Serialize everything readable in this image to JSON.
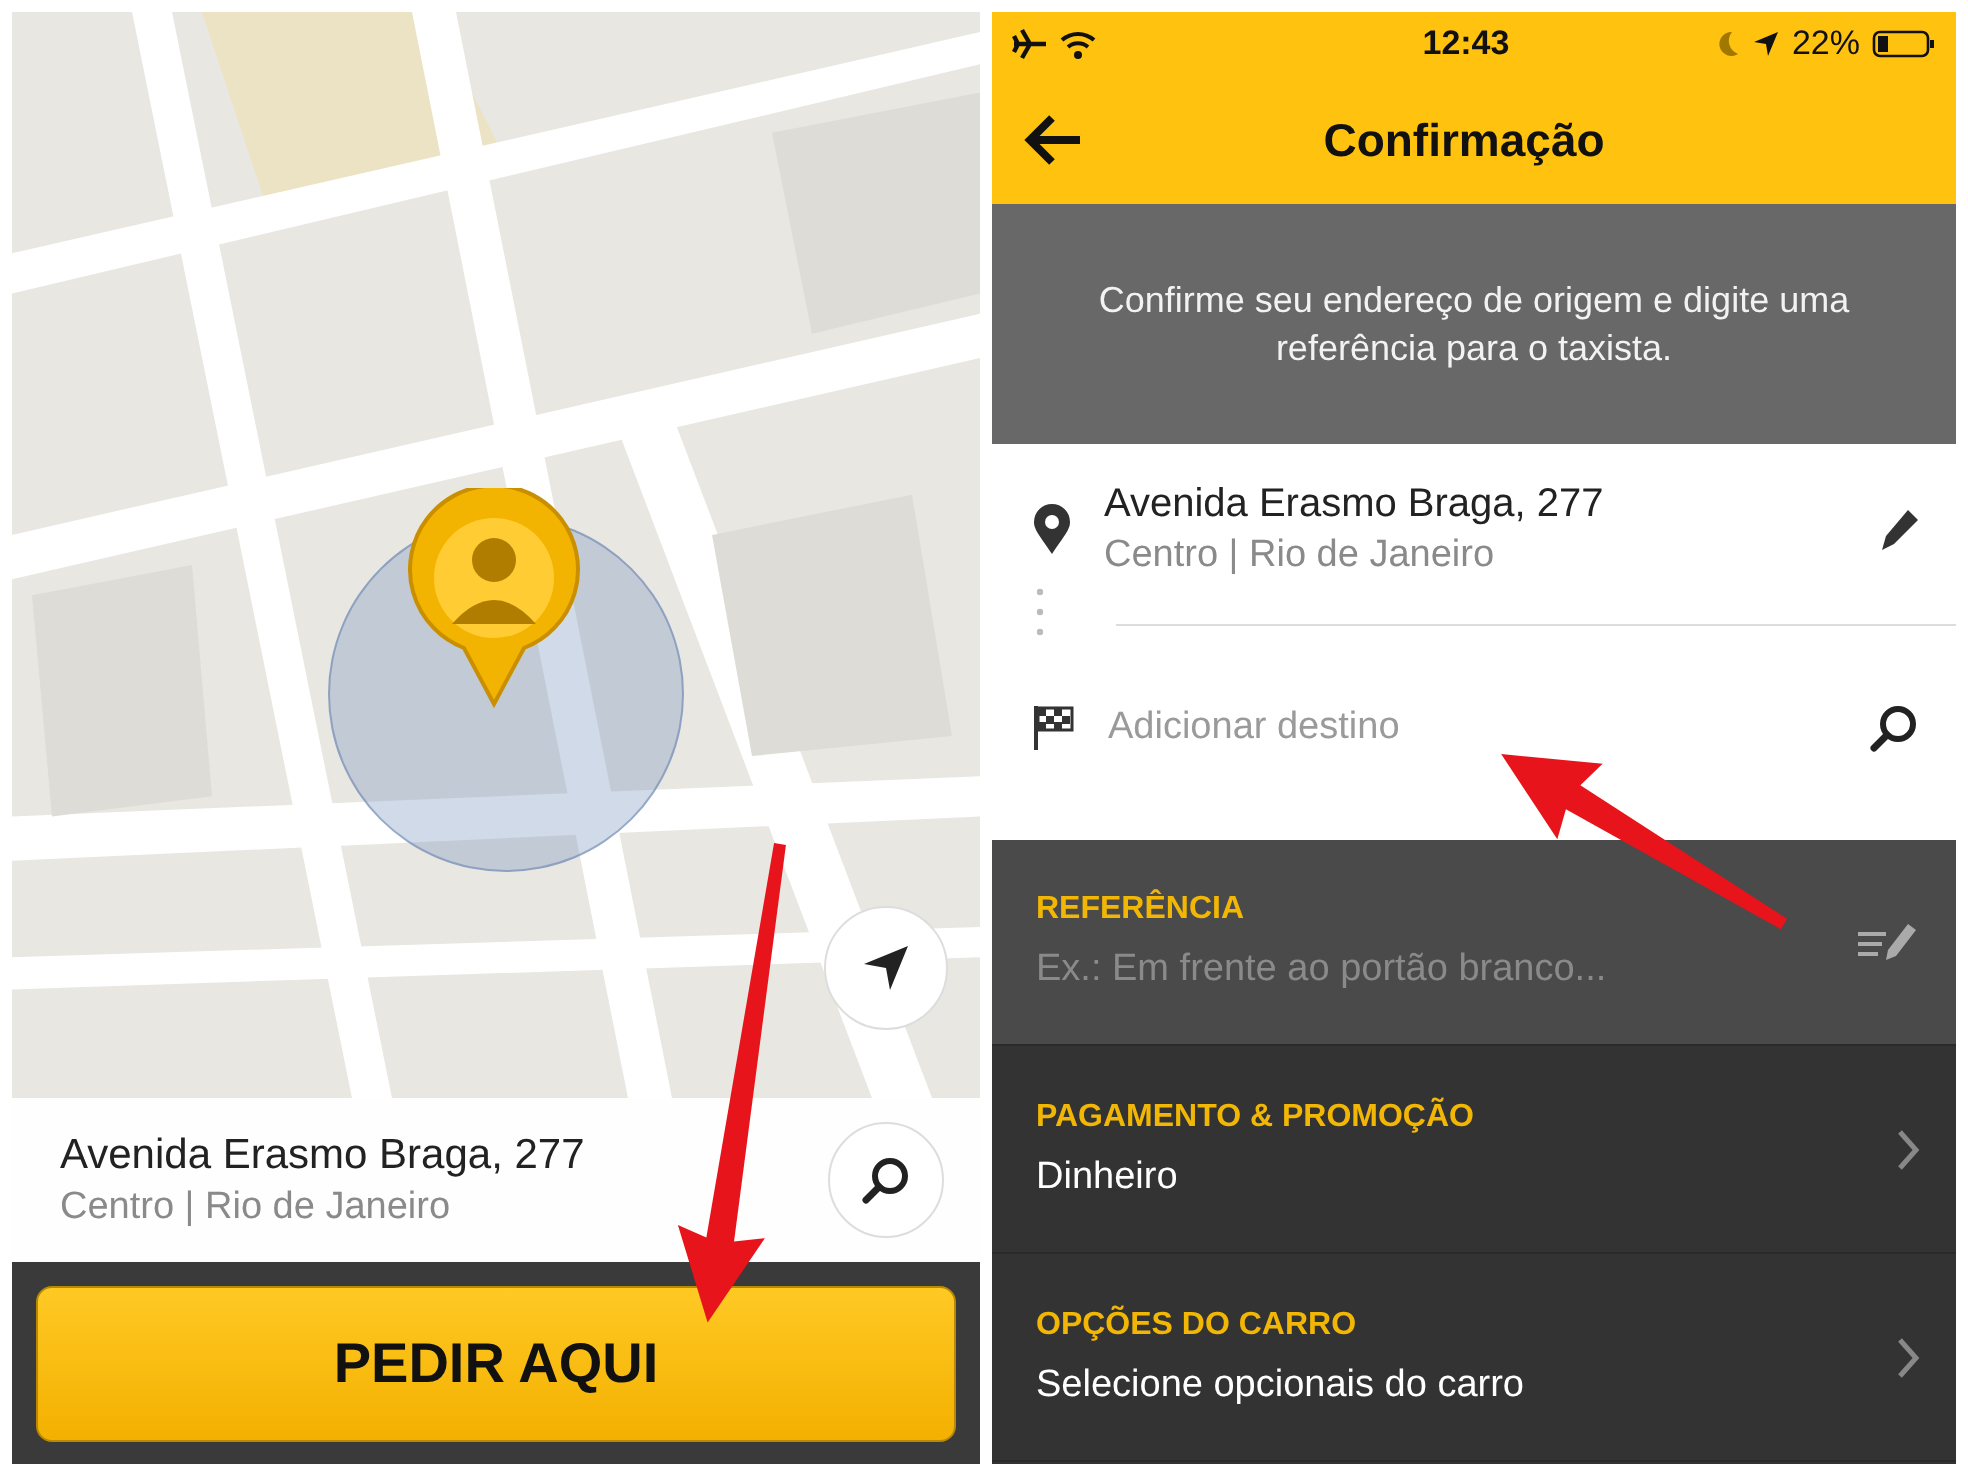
{
  "left_screen": {
    "address": {
      "street": "Avenida Erasmo Braga, 277",
      "area": "Centro | Rio de Janeiro"
    },
    "order_button": "PEDIR AQUI"
  },
  "right_screen": {
    "status_bar": {
      "time": "12:43",
      "battery": "22%"
    },
    "header": {
      "title": "Confirmação"
    },
    "banner": "Confirme seu endereço de origem e digite uma referência para o taxista.",
    "origin": {
      "street": "Avenida Erasmo Braga, 277",
      "area": "Centro | Rio de Janeiro"
    },
    "destination": {
      "placeholder": "Adicionar destino"
    },
    "sections": [
      {
        "kind": "input",
        "label": "REFERÊNCIA",
        "placeholder": "Ex.: Em frente ao portão branco..."
      },
      {
        "kind": "link",
        "label": "PAGAMENTO & PROMOÇÃO",
        "value": "Dinheiro"
      },
      {
        "kind": "link",
        "label": "OPÇÕES DO CARRO",
        "value": "Selecione opcionais do carro"
      }
    ]
  }
}
